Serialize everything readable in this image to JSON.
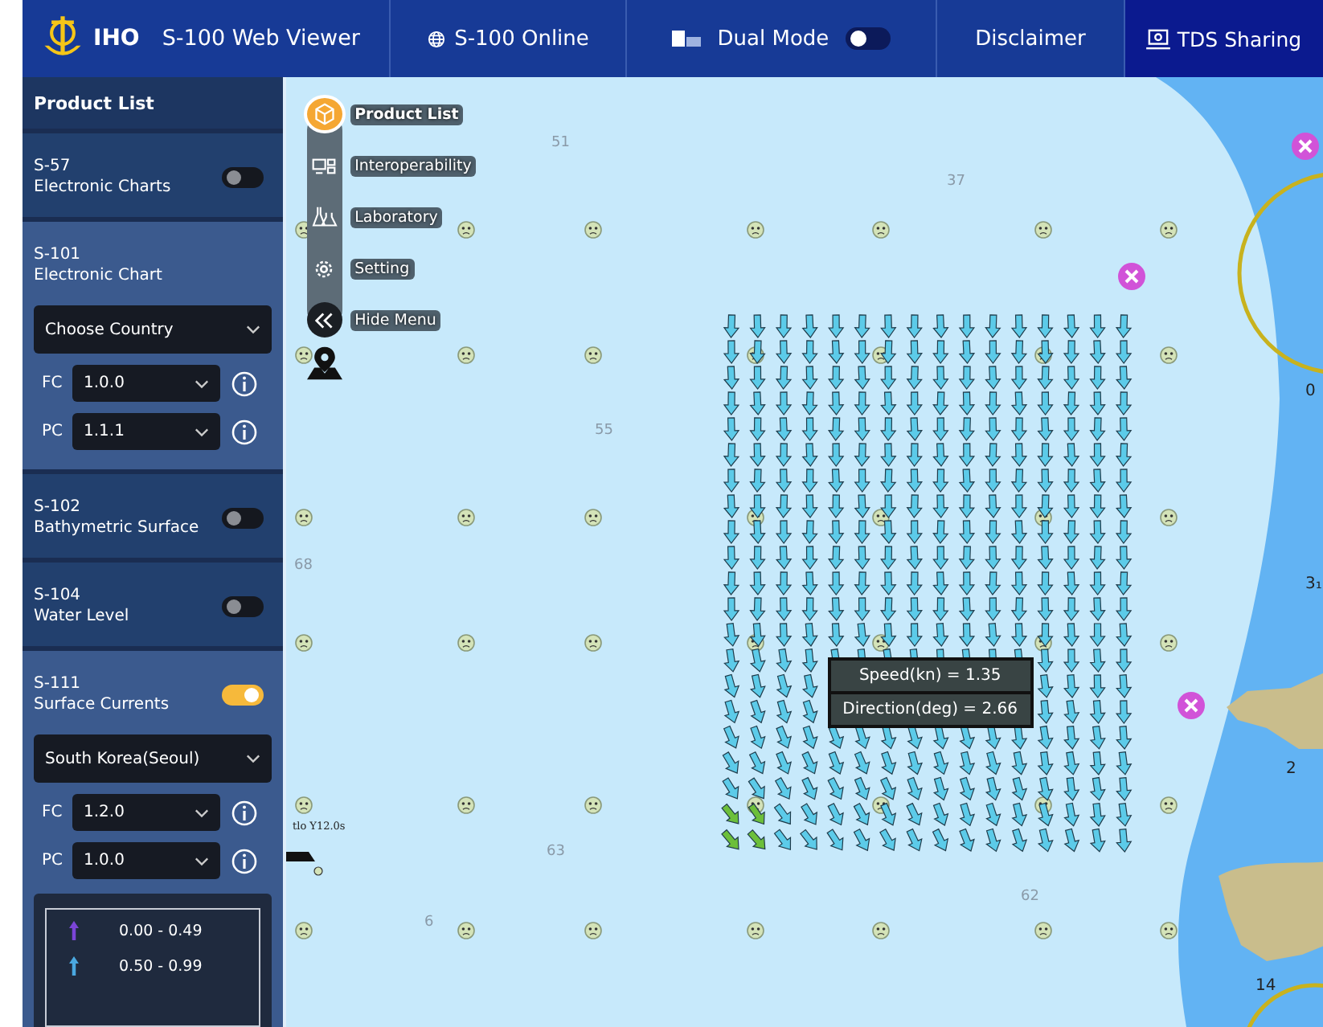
{
  "header": {
    "logo": "IHO",
    "title": "S-100 Web Viewer",
    "nav": [
      {
        "label": "S-100 Online",
        "kind": "online",
        "selected": false
      },
      {
        "label": "Dual Mode",
        "kind": "toggle",
        "on": false,
        "selected": false
      },
      {
        "label": "Disclaimer",
        "kind": "plain",
        "selected": false
      },
      {
        "label": "TDS Sharing",
        "kind": "sharing",
        "selected": true
      }
    ]
  },
  "sidebar": {
    "title": "Product List",
    "products": [
      {
        "code": "S-57",
        "name": "Electronic Charts",
        "kind": "switch",
        "on": false,
        "expanded": false
      },
      {
        "code": "S-101",
        "name": "Electronic Chart",
        "kind": "panel",
        "expanded": true,
        "settings": {
          "country": "Choose Country",
          "fc": {
            "label": "FC",
            "value": "1.0.0"
          },
          "pc": {
            "label": "PC",
            "value": "1.1.1"
          }
        }
      },
      {
        "code": "S-102",
        "name": "Bathymetric Surface",
        "kind": "switch",
        "on": false,
        "expanded": false
      },
      {
        "code": "S-104",
        "name": "Water Level",
        "kind": "switch",
        "on": false,
        "expanded": false
      },
      {
        "code": "S-111",
        "name": "Surface Currents",
        "kind": "switch",
        "on": true,
        "expanded": true,
        "settings": {
          "country": "South Korea(Seoul)",
          "fc": {
            "label": "FC",
            "value": "1.2.0"
          },
          "pc": {
            "label": "PC",
            "value": "1.0.0"
          }
        },
        "legend": [
          {
            "range": "0.00 - 0.49",
            "color": "#7b45d8"
          },
          {
            "range": "0.50 - 0.99",
            "color": "#4aa8e0"
          }
        ]
      }
    ]
  },
  "map_menu": [
    {
      "label": "Product List",
      "kind": "products",
      "selected": true
    },
    {
      "label": "Interoperability",
      "kind": "interop",
      "selected": false
    },
    {
      "label": "Laboratory",
      "kind": "lab",
      "selected": false
    },
    {
      "label": "Setting",
      "kind": "settings",
      "selected": false
    },
    {
      "label": "Hide Menu",
      "kind": "hide",
      "selected": false
    }
  ],
  "map": {
    "soundings": [
      "51",
      "37",
      "55",
      "68",
      "63",
      "62",
      "6",
      "2",
      "3₁",
      "0",
      "14"
    ],
    "light_label": "tlo Y12.0s",
    "tooltip": [
      "Speed(kn) = 1.35",
      "Direction(deg) = 2.66"
    ]
  }
}
